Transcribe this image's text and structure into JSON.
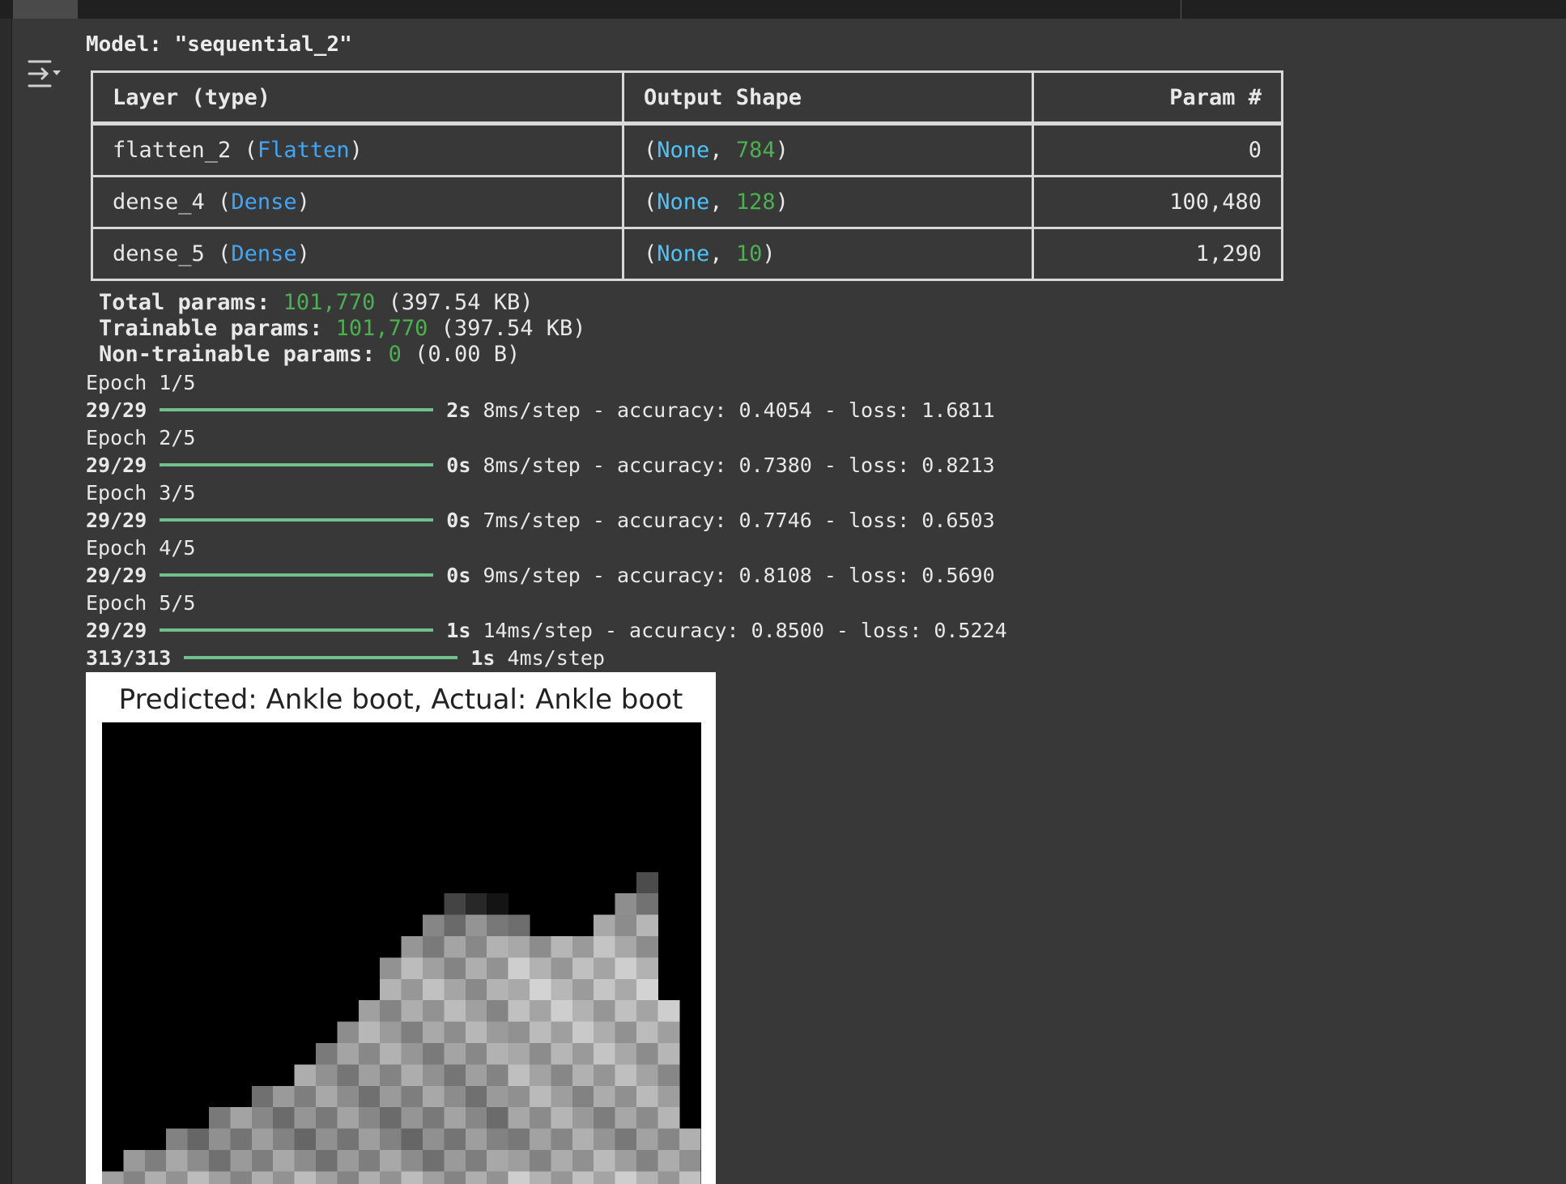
{
  "icons": {
    "output_toggle": "output-collapse-icon"
  },
  "model_title": "Model: \"sequential_2\"",
  "summary": {
    "headers": [
      "Layer (type)",
      "Output Shape",
      "Param #"
    ],
    "rows": [
      {
        "name": "flatten_2",
        "type": "Flatten",
        "shape_none": "None",
        "shape_dim": "784",
        "params": "0"
      },
      {
        "name": "dense_4",
        "type": "Dense",
        "shape_none": "None",
        "shape_dim": "128",
        "params": "100,480"
      },
      {
        "name": "dense_5",
        "type": "Dense",
        "shape_none": "None",
        "shape_dim": "10",
        "params": "1,290"
      }
    ]
  },
  "params": {
    "total": {
      "label": "Total params:",
      "value": "101,770",
      "size": "(397.54 KB)"
    },
    "trainable": {
      "label": "Trainable params:",
      "value": "101,770",
      "size": "(397.54 KB)"
    },
    "non_trainable": {
      "label": "Non-trainable params:",
      "value": "0",
      "size": "(0.00 B)"
    }
  },
  "training": {
    "epochs": [
      {
        "epoch": "Epoch 1/5",
        "step": "29/29",
        "time": "2s",
        "rest": "8ms/step - accuracy: 0.4054 - loss: 1.6811",
        "progress": 1.0
      },
      {
        "epoch": "Epoch 2/5",
        "step": "29/29",
        "time": "0s",
        "rest": "8ms/step - accuracy: 0.7380 - loss: 0.8213",
        "progress": 1.0
      },
      {
        "epoch": "Epoch 3/5",
        "step": "29/29",
        "time": "0s",
        "rest": "7ms/step - accuracy: 0.7746 - loss: 0.6503",
        "progress": 1.0
      },
      {
        "epoch": "Epoch 4/5",
        "step": "29/29",
        "time": "0s",
        "rest": "9ms/step - accuracy: 0.8108 - loss: 0.5690",
        "progress": 1.0
      },
      {
        "epoch": "Epoch 5/5",
        "step": "29/29",
        "time": "1s",
        "rest": "14ms/step - accuracy: 0.8500 - loss: 0.5224",
        "progress": 1.0
      }
    ],
    "evaluate": {
      "step": "313/313",
      "time": "1s",
      "rest": "4ms/step",
      "progress": 1.0
    }
  },
  "figure": {
    "title": "Predicted: Ankle boot, Actual: Ankle boot"
  },
  "colors": {
    "background": "#383838",
    "number_green": "#4caf50",
    "none_cyan": "#4fc3f7",
    "type_blue": "#42a5f5",
    "progress_bar": "#6fbf8f"
  }
}
